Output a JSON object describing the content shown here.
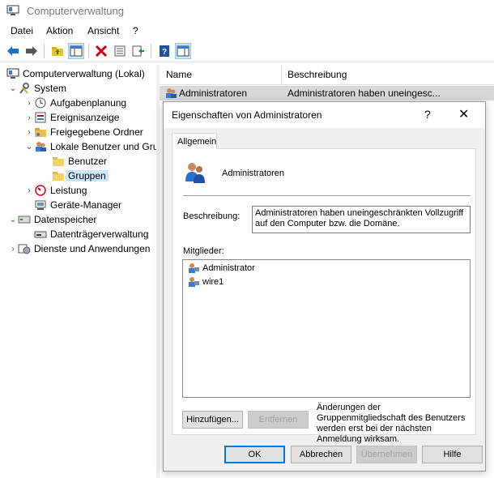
{
  "window": {
    "title": "Computerverwaltung"
  },
  "menu": [
    "Datei",
    "Aktion",
    "Ansicht",
    "?"
  ],
  "tree": {
    "root": "Computerverwaltung (Lokal)",
    "system": "System",
    "task_scheduler": "Aufgabenplanung",
    "event_viewer": "Ereignisanzeige",
    "shared_folders": "Freigegebene Ordner",
    "local_users": "Lokale Benutzer und Gru",
    "users": "Benutzer",
    "groups": "Gruppen",
    "performance": "Leistung",
    "device_manager": "Geräte-Manager",
    "storage": "Datenspeicher",
    "disk_management": "Datenträgerverwaltung",
    "services": "Dienste und Anwendungen"
  },
  "list": {
    "col_name": "Name",
    "col_desc": "Beschreibung",
    "row_name": "Administratoren",
    "row_desc": "Administratoren haben uneingesc..."
  },
  "dialog": {
    "title": "Eigenschaften von Administratoren",
    "help": "?",
    "close": "✕",
    "tab": "Allgemein",
    "group_name": "Administratoren",
    "desc_label": "Beschreibung:",
    "desc_value": "Administratoren haben uneingeschränkten Vollzugriff auf den Computer bzw. die Domäne.",
    "members_label": "Mitglieder:",
    "members": [
      "Administrator",
      "wire1"
    ],
    "add_button": "Hinzufügen...",
    "remove_button": "Entfernen",
    "note": "Änderungen der Gruppenmitgliedschaft des Benutzers werden erst bei der nächsten Anmeldung wirksam.",
    "ok": "OK",
    "cancel": "Abbrechen",
    "apply": "Übernehmen",
    "help_button": "Hilfe"
  }
}
